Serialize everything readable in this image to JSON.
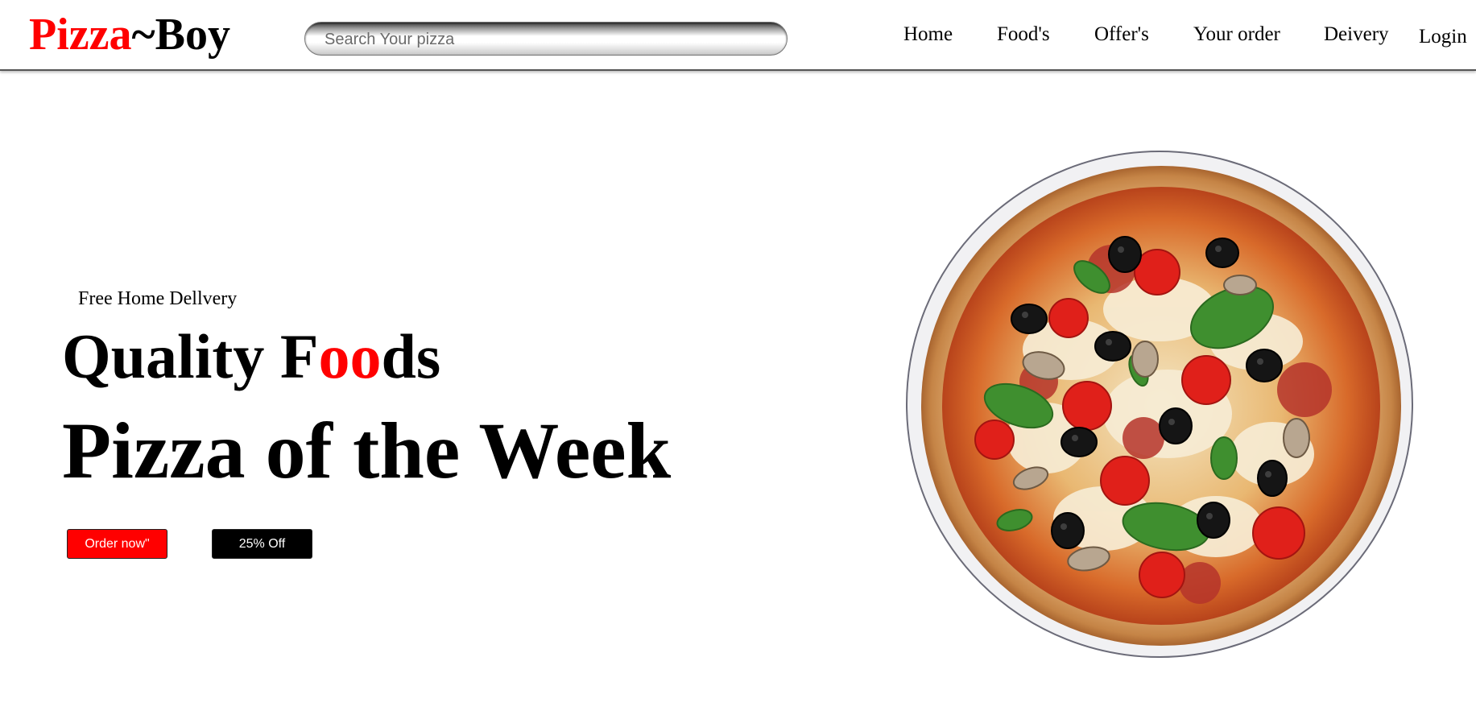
{
  "header": {
    "logo_part1": "Pizza",
    "logo_part2": "~Boy",
    "search_placeholder": "Search Your pizza",
    "nav": {
      "home": "Home",
      "foods": "Food's",
      "offers": "Offer's",
      "order": "Your order",
      "delivery": "Deivery",
      "login": "Login"
    }
  },
  "hero": {
    "tagline": "Free Home Dellvery",
    "quality_prefix": "Quality F",
    "quality_highlight": "oo",
    "quality_suffix": "ds",
    "headline": "Pizza of the Week",
    "order_button": "Order now\"",
    "discount_button": "25% Off"
  },
  "colors": {
    "accent": "#ff0000",
    "text": "#000000",
    "background": "#ffffff"
  },
  "icons": {
    "hero_image": "pizza-image"
  }
}
